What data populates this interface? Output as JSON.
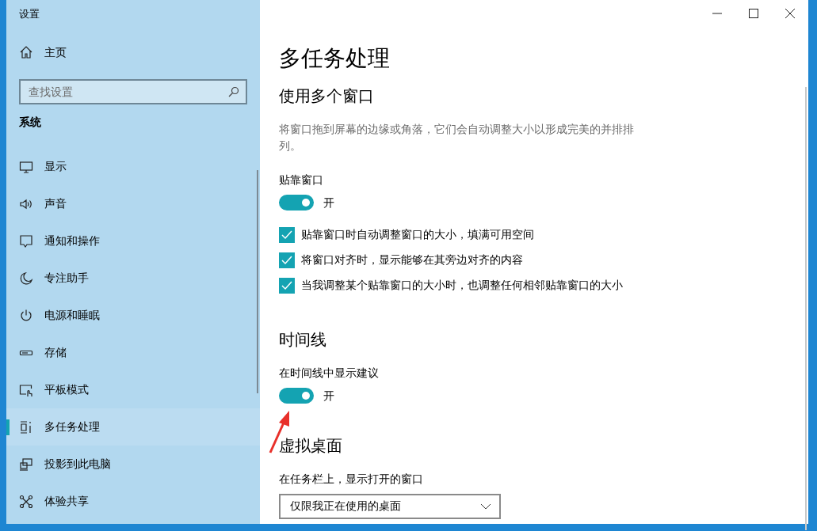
{
  "window": {
    "title": "设置"
  },
  "sidebar": {
    "home": "主页",
    "search": {
      "placeholder": "查找设置"
    },
    "section": "系统",
    "items": [
      {
        "label": "显示",
        "selected": false
      },
      {
        "label": "声音",
        "selected": false
      },
      {
        "label": "通知和操作",
        "selected": false
      },
      {
        "label": "专注助手",
        "selected": false
      },
      {
        "label": "电源和睡眠",
        "selected": false
      },
      {
        "label": "存储",
        "selected": false
      },
      {
        "label": "平板模式",
        "selected": false
      },
      {
        "label": "多任务处理",
        "selected": true
      },
      {
        "label": "投影到此电脑",
        "selected": false
      },
      {
        "label": "体验共享",
        "selected": false
      }
    ]
  },
  "page": {
    "title": "多任务处理",
    "sections": [
      {
        "heading": "使用多个窗口",
        "description": "将窗口拖到屏幕的边缘或角落，它们会自动调整大小以形成完美的并排排列。",
        "settings": [
          {
            "kind": "toggle",
            "label": "贴靠窗口",
            "on": true,
            "state_text": "开"
          },
          {
            "kind": "checkbox",
            "label": "贴靠窗口时自动调整窗口的大小，填满可用空间",
            "checked": true
          },
          {
            "kind": "checkbox",
            "label": "将窗口对齐时，显示能够在其旁边对齐的内容",
            "checked": true
          },
          {
            "kind": "checkbox",
            "label": "当我调整某个贴靠窗口的大小时，也调整任何相邻贴靠窗口的大小",
            "checked": true
          }
        ]
      },
      {
        "heading": "时间线",
        "settings": [
          {
            "kind": "toggle",
            "label": "在时间线中显示建议",
            "on": true,
            "state_text": "开"
          }
        ]
      },
      {
        "heading": "虚拟桌面",
        "settings": [
          {
            "kind": "dropdown",
            "label": "在任务栏上，显示打开的窗口",
            "value": "仅限我正在使用的桌面"
          }
        ]
      }
    ]
  }
}
